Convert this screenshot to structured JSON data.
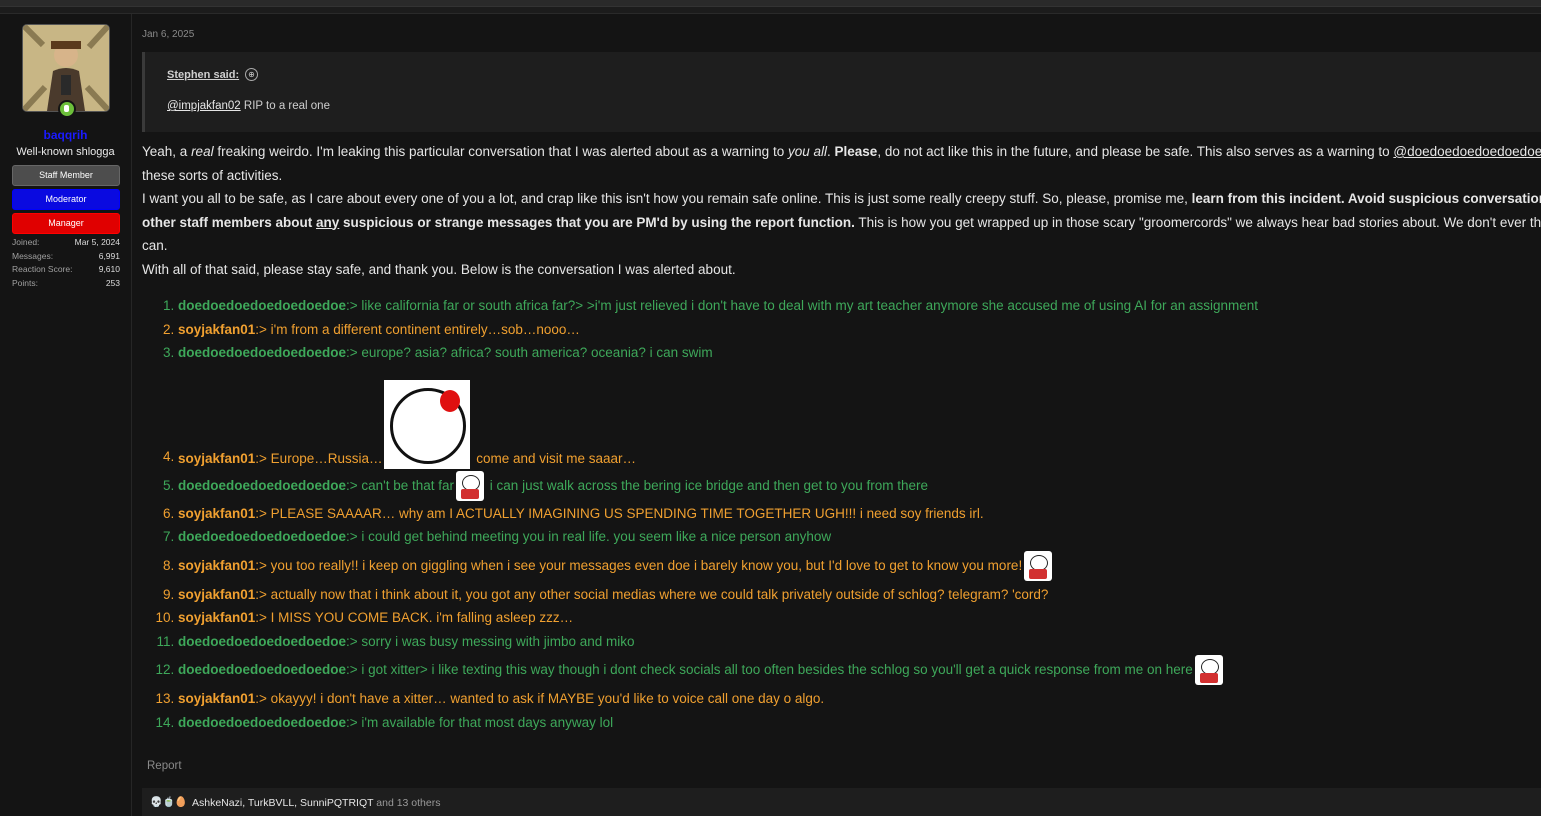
{
  "user": {
    "name": "baqqrih",
    "title": "Well-known shlogga",
    "banners": [
      "Staff Member",
      "Moderator",
      "Manager"
    ],
    "stats": [
      {
        "label": "Joined:",
        "value": "Mar 5, 2024"
      },
      {
        "label": "Messages:",
        "value": "6,991"
      },
      {
        "label": "Reaction Score:",
        "value": "9,610"
      },
      {
        "label": "Points:",
        "value": "253"
      }
    ],
    "online_icon": "online-status-icon"
  },
  "post": {
    "date": "Jan 6, 2025",
    "quote": {
      "author": "Stephen said:",
      "arrow_icon": "⊕",
      "mention": "@impjakfan02",
      "text": " RIP to a real one"
    },
    "p1": {
      "t1": "Yeah, a ",
      "t2": "real",
      "t3": " freaking weirdo. I'm leaking this particular conversation that I was alerted about as a warning to ",
      "t4": "you all",
      "t5": ". ",
      "t6": "Please",
      "t7": ", do not act like this in the future, and please be safe. This also serves as a warning to ",
      "t8": "@doedoedoedoedoedoedoedoe",
      "line2": "these sorts of activities."
    },
    "p2": {
      "t1": "I want you all to be safe, as I care about every one of you a lot, and crap like this isn't how you remain safe online. This is just some really creepy stuff. So, please, promise me, ",
      "t2": "learn from this incident. Avoid suspicious conversations",
      "l2b1": "other staff members about ",
      "l2b2": "any",
      "l2b3": " suspicious or strange messages that you are PM'd by using the report function.",
      "l2t": " This is how you get wrapped up in those scary \"groomercords\" we always hear bad stories about. We don't ever th",
      "line3": "can."
    },
    "p3": "With all of that said, please stay safe, and thank you. Below is the conversation I was alerted about.",
    "convo": [
      {
        "who": "doedoedoedoedoedoedoe",
        "text": ":> like california far or south africa far?> >i'm just relieved i don't have to deal with my art teacher anymore she accused me of using AI for an assignment"
      },
      {
        "who": "soyjakfan01",
        "text": ":> i'm from a different continent entirely…sob…nooo…"
      },
      {
        "who": "doedoedoedoedoedoedoe",
        "text": ":> europe? asia? africa? south america? oceania? i can swim"
      },
      {
        "who": "soyjakfan01",
        "text": ":> Europe…Russia…",
        "text2": " come and visit me saaar…"
      },
      {
        "who": "doedoedoedoedoedoedoe",
        "text": ":> can't be that far",
        "text2": " i can just walk across the bering ice bridge and then get to you from there"
      },
      {
        "who": "soyjakfan01",
        "text": ":> PLEASE SAAAAR… why am I ACTUALLY IMAGINING US SPENDING TIME TOGETHER UGH!!! i need soy friends irl."
      },
      {
        "who": "doedoedoedoedoedoedoe",
        "text": ":> i could get behind meeting you in real life. you seem like a nice person anyhow"
      },
      {
        "who": "soyjakfan01",
        "text": ":> you too really!! i keep on giggling when i see your messages even doe i barely know you, but I'd love to get to know you more!"
      },
      {
        "who": "soyjakfan01",
        "text": ":> actually now that i think about it, you got any other social medias where we could talk privately outside of schlog? telegram? 'cord?"
      },
      {
        "who": "soyjakfan01",
        "text": ":> I MISS YOU COME BACK. i'm falling asleep zzz…"
      },
      {
        "who": "doedoedoedoedoedoedoe",
        "text": ":> sorry i was busy messing with jimbo and miko"
      },
      {
        "who": "doedoedoedoedoedoedoe",
        "text": ":> i got xitter> i like texting this way though i dont check socials all too often besides the schlog so you'll get a quick response from me on here"
      },
      {
        "who": "soyjakfan01",
        "text": ":> okayyy! i don't have a xitter… wanted to ask if MAYBE you'd like to voice call one day o algo."
      },
      {
        "who": "doedoedoedoedoedoedoe",
        "text": ":> i'm available for that most days anyway lol"
      }
    ],
    "report": "Report",
    "reactions": {
      "icons": "💀🍵🥚",
      "names": [
        "AshkeNazi",
        "TurkBVLL",
        "SunniPQTRIQT"
      ],
      "others": " and 13 others"
    }
  },
  "colors": {
    "green": "#3ea85a",
    "orange": "#f0a030",
    "username_blue": "#1a1aff"
  }
}
